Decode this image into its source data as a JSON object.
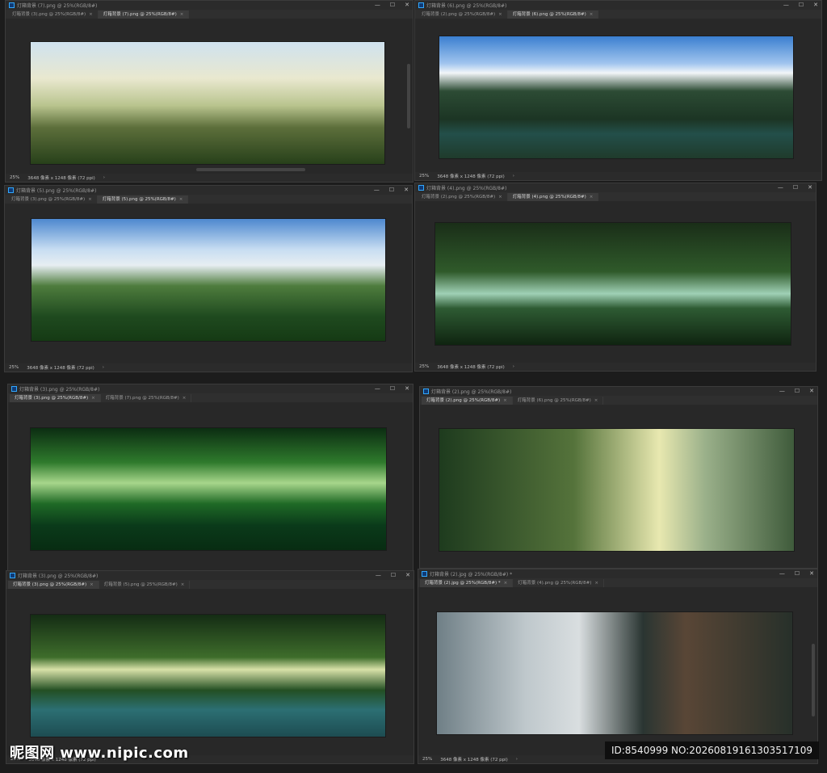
{
  "windows": [
    {
      "id": "w1",
      "title": "灯箱背景 (7).png @ 25%(RGB/8#)",
      "tabs": [
        {
          "label": "灯箱背景 (3).png @ 25%(RGB/8#)",
          "active": false
        },
        {
          "label": "灯箱背景 (7).png @ 25%(RGB/8#)",
          "active": true
        }
      ],
      "zoom": "25%",
      "doc_size": "3648 像素 x 1248 像素 (72 ppi)"
    },
    {
      "id": "w2",
      "title": "灯箱背景 (6).png @ 25%(RGB/8#)",
      "tabs": [
        {
          "label": "灯箱背景 (2).png @ 25%(RGB/8#)",
          "active": false
        },
        {
          "label": "灯箱背景 (6).png @ 25%(RGB/8#)",
          "active": true
        }
      ],
      "zoom": "25%",
      "doc_size": "3648 像素 x 1248 像素 (72 ppi)"
    },
    {
      "id": "w3",
      "title": "灯箱背景 (5).png @ 25%(RGB/8#)",
      "tabs": [
        {
          "label": "灯箱背景 (3).png @ 25%(RGB/8#)",
          "active": false
        },
        {
          "label": "灯箱背景 (5).png @ 25%(RGB/8#)",
          "active": true
        }
      ],
      "zoom": "25%",
      "doc_size": "3648 像素 x 1248 像素 (72 ppi)"
    },
    {
      "id": "w4",
      "title": "灯箱背景 (4).png @ 25%(RGB/8#)",
      "tabs": [
        {
          "label": "灯箱背景 (2).png @ 25%(RGB/8#)",
          "active": false
        },
        {
          "label": "灯箱背景 (4).png @ 25%(RGB/8#)",
          "active": true
        }
      ],
      "zoom": "25%",
      "doc_size": "3648 像素 x 1248 像素 (72 ppi)"
    },
    {
      "id": "w5",
      "title": "灯箱背景 (3).png @ 25%(RGB/8#)",
      "tabs": [
        {
          "label": "灯箱背景 (3).png @ 25%(RGB/8#)",
          "active": true
        },
        {
          "label": "灯箱背景 (7).png @ 25%(RGB/8#)",
          "active": false
        }
      ],
      "zoom": "",
      "doc_size": ""
    },
    {
      "id": "w6",
      "title": "灯箱背景 (2).png @ 25%(RGB/8#)",
      "tabs": [
        {
          "label": "灯箱背景 (2).png @ 25%(RGB/8#)",
          "active": true
        },
        {
          "label": "灯箱背景 (6).png @ 25%(RGB/8#)",
          "active": false
        }
      ],
      "zoom": "",
      "doc_size": ""
    },
    {
      "id": "w7",
      "title": "灯箱背景 (3).png @ 25%(RGB/8#)",
      "tabs": [
        {
          "label": "灯箱背景 (3).png @ 25%(RGB/8#)",
          "active": true
        },
        {
          "label": "灯箱背景 (5).png @ 25%(RGB/8#)",
          "active": false
        }
      ],
      "zoom": "25%",
      "doc_size": "3648 像素 x 1248 像素 (72 ppi)"
    },
    {
      "id": "w8",
      "title": "灯箱背景 (2).jpg @ 25%(RGB/8#) *",
      "tabs": [
        {
          "label": "灯箱背景 (2).jpg @ 25%(RGB/8#) *",
          "active": true
        },
        {
          "label": "灯箱背景 (4).png @ 25%(RGB/8#)",
          "active": false
        }
      ],
      "zoom": "25%",
      "doc_size": "3648 像素 x 1248 像素 (72 ppi)"
    }
  ],
  "icons": {
    "minimize": "—",
    "maximize": "☐",
    "close": "✕",
    "tab_close": "×",
    "status_arrow": "›"
  },
  "colors": {
    "window_bg": "#262626",
    "accent_ps_blue": "#31a8ff"
  },
  "watermark": {
    "text": "昵图网 www.nipic.com"
  },
  "id_bar": {
    "text": "ID:8540999 NO:20260819161303517109"
  }
}
